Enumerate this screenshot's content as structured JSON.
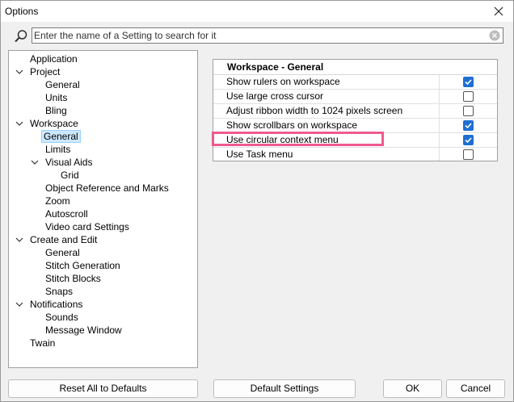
{
  "window": {
    "title": "Options"
  },
  "search": {
    "placeholder": "Enter the name of a Setting to search for it"
  },
  "tree": {
    "items": [
      {
        "label": "Application"
      },
      {
        "label": "Project"
      },
      {
        "label": "General"
      },
      {
        "label": "Units"
      },
      {
        "label": "Bling"
      },
      {
        "label": "Workspace"
      },
      {
        "label": "General"
      },
      {
        "label": "Limits"
      },
      {
        "label": "Visual Aids"
      },
      {
        "label": "Grid"
      },
      {
        "label": "Object Reference and Marks"
      },
      {
        "label": "Zoom"
      },
      {
        "label": "Autoscroll"
      },
      {
        "label": "Video card Settings"
      },
      {
        "label": "Create and Edit"
      },
      {
        "label": "General"
      },
      {
        "label": "Stitch Generation"
      },
      {
        "label": "Stitch Blocks"
      },
      {
        "label": "Snaps"
      },
      {
        "label": "Notifications"
      },
      {
        "label": "Sounds"
      },
      {
        "label": "Message Window"
      },
      {
        "label": "Twain"
      }
    ],
    "selected": "Workspace / General"
  },
  "settings": {
    "header": "Workspace - General",
    "rows": [
      {
        "label": "Show rulers on workspace",
        "checked": true
      },
      {
        "label": "Use large cross cursor",
        "checked": false
      },
      {
        "label": "Adjust ribbon width to 1024 pixels screen",
        "checked": false
      },
      {
        "label": "Show scrollbars on workspace",
        "checked": true
      },
      {
        "label": "Use circular context menu",
        "checked": true
      },
      {
        "label": "Use Task menu",
        "checked": false
      }
    ]
  },
  "buttons": {
    "reset": "Reset All to Defaults",
    "defaults": "Default Settings",
    "ok": "OK",
    "cancel": "Cancel"
  },
  "colors": {
    "accent": "#1f6fd1",
    "highlight": "#ee5a90",
    "selection": "#cce8ff"
  }
}
